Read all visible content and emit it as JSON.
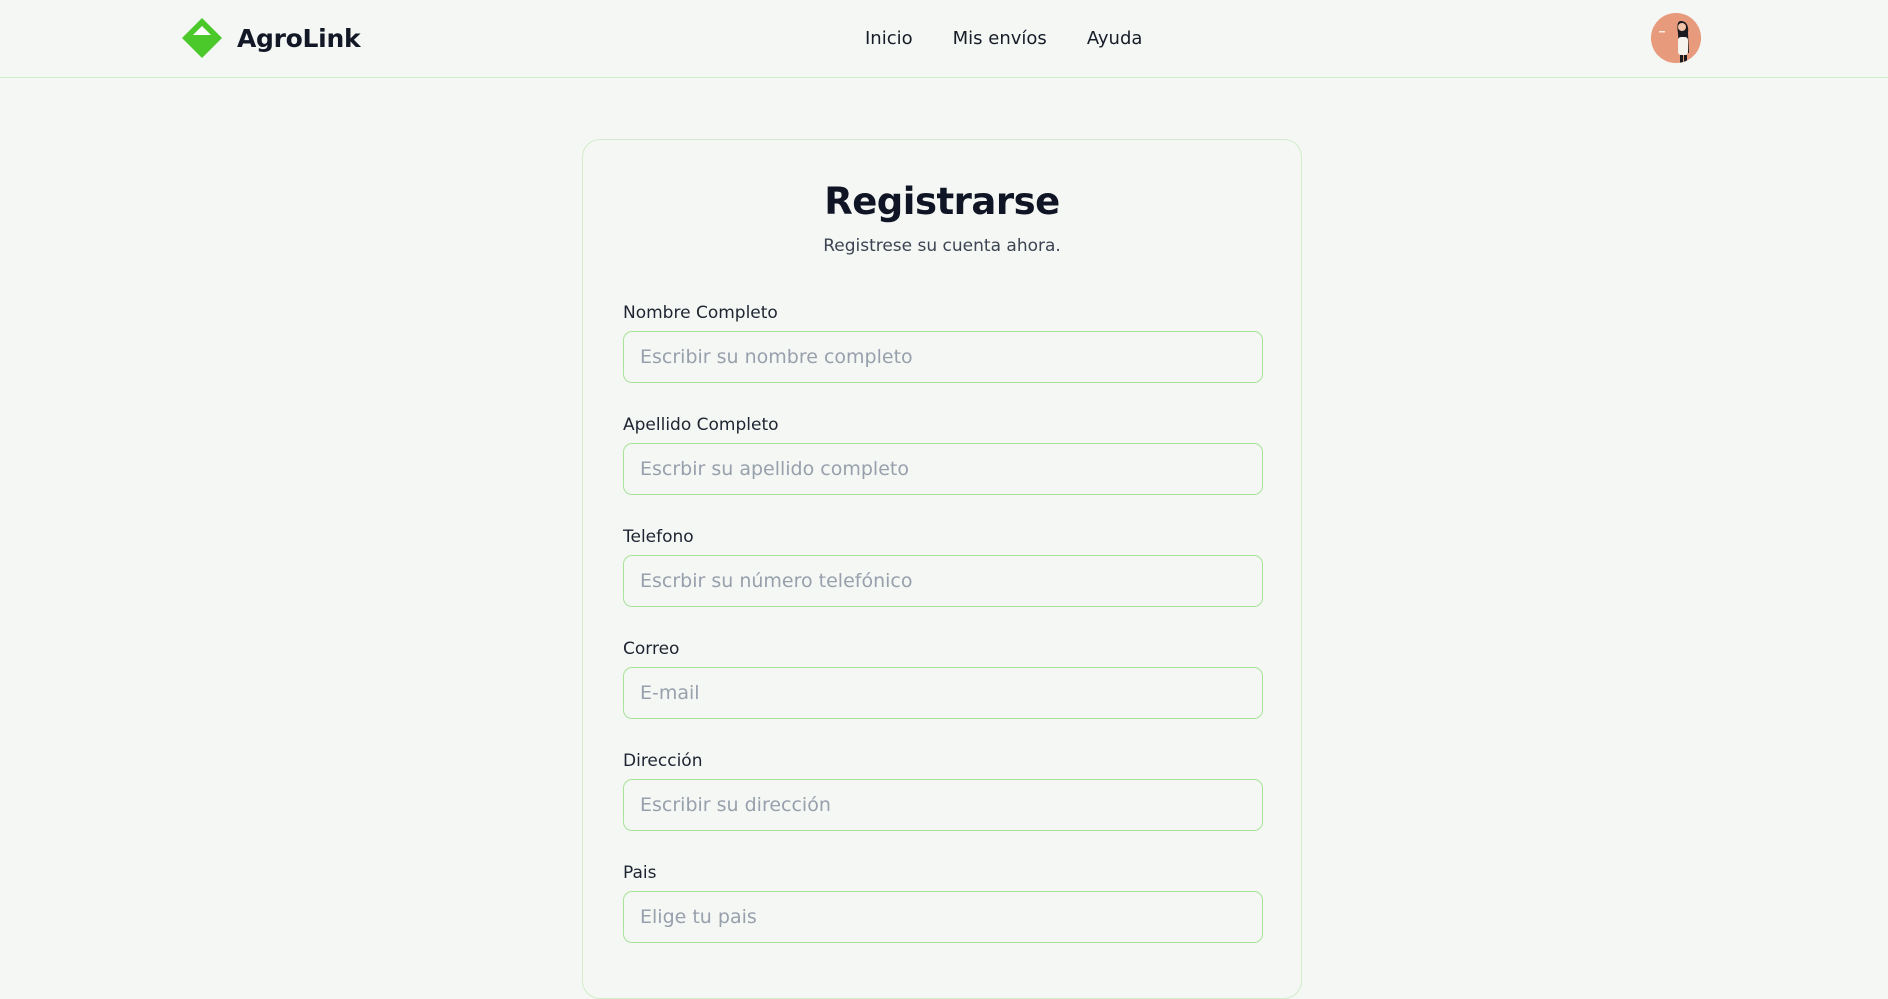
{
  "header": {
    "brand_name": "AgroLink",
    "brand_color": "#4cc92a",
    "nav": [
      {
        "label": "Inicio"
      },
      {
        "label": "Mis envíos"
      },
      {
        "label": "Ayuda"
      }
    ],
    "avatar_icon": "user-avatar"
  },
  "form": {
    "title": "Registrarse",
    "subtitle": "Registrese su cuenta ahora.",
    "fields": [
      {
        "label": "Nombre Completo",
        "placeholder": "Escribir su nombre completo",
        "value": ""
      },
      {
        "label": "Apellido Completo",
        "placeholder": "Escrbir su apellido completo",
        "value": ""
      },
      {
        "label": "Telefono",
        "placeholder": "Escrbir su número telefónico",
        "value": ""
      },
      {
        "label": "Correo",
        "placeholder": "E-mail",
        "value": ""
      },
      {
        "label": "Dirección",
        "placeholder": "Escribir su dirección",
        "value": ""
      },
      {
        "label": "Pais",
        "placeholder": "Elige tu pais",
        "value": ""
      }
    ]
  },
  "colors": {
    "background": "#f4f7f3",
    "border_accent": "#a8e39a",
    "text_dark": "#0f1524"
  }
}
